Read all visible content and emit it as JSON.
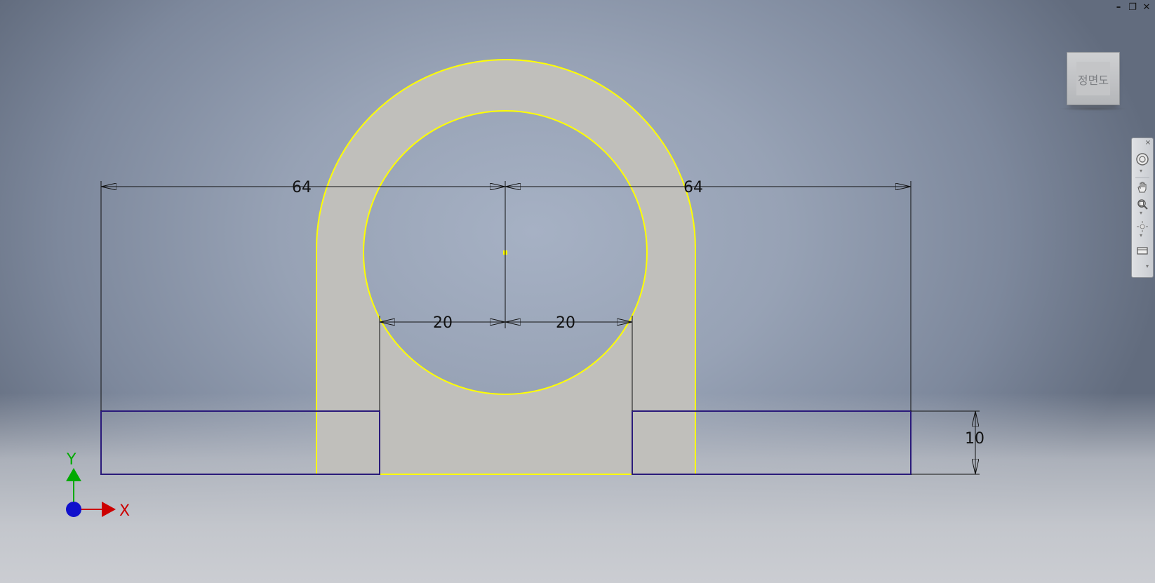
{
  "window": {
    "minimize_glyph": "–",
    "restore_glyph": "❐",
    "close_glyph": "✕"
  },
  "view_cube": {
    "face_label": "정면도"
  },
  "nav_bar": {
    "close_glyph": "×",
    "items": [
      {
        "icon": "steering-wheel-icon"
      },
      {
        "icon": "pan-hand-icon"
      },
      {
        "icon": "zoom-icon"
      },
      {
        "icon": "orbit-icon"
      },
      {
        "icon": "look-at-icon"
      }
    ]
  },
  "sketch": {
    "profile_color": "#ffff00",
    "fill_color": "#c0bfbb",
    "constraint_color": "#2a1a7a",
    "dimensions": [
      {
        "name": "dim-left-64",
        "value": "64"
      },
      {
        "name": "dim-right-64",
        "value": "64"
      },
      {
        "name": "dim-left-20",
        "value": "20"
      },
      {
        "name": "dim-right-20",
        "value": "20"
      },
      {
        "name": "dim-height-10",
        "value": "10"
      }
    ]
  },
  "triad": {
    "x_label": "X",
    "y_label": "Y",
    "x_color": "#cc0000",
    "y_color": "#00aa00",
    "origin_color": "#1010cc"
  }
}
